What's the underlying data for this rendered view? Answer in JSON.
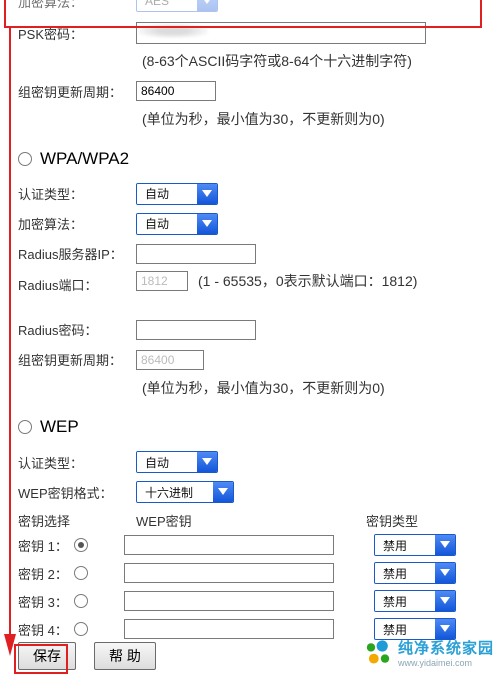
{
  "top": {
    "encrypt_algo_label": "加密算法：",
    "encrypt_algo_value": "AES",
    "psk_label": "PSK密码：",
    "psk_value": "",
    "psk_hint": "(8-63个ASCII码字符或8-64个十六进制字符)",
    "group_key_label": "组密钥更新周期：",
    "group_key_value": "86400",
    "group_key_hint": "(单位为秒，最小值为30，不更新则为0)"
  },
  "wpa": {
    "section_title": "WPA/WPA2",
    "auth_label": "认证类型：",
    "auth_value": "自动",
    "encrypt_label": "加密算法：",
    "encrypt_value": "自动",
    "radius_ip_label": "Radius服务器IP：",
    "radius_ip_value": "",
    "radius_port_label": "Radius端口：",
    "radius_port_value": "1812",
    "radius_port_hint": "(1 - 65535，0表示默认端口：1812)",
    "radius_pw_label": "Radius密码：",
    "radius_pw_value": "",
    "group_key_label": "组密钥更新周期：",
    "group_key_value": "86400",
    "group_key_hint": "(单位为秒，最小值为30，不更新则为0)"
  },
  "wep": {
    "section_title": "WEP",
    "auth_label": "认证类型：",
    "auth_value": "自动",
    "format_label": "WEP密钥格式：",
    "format_value": "十六进制",
    "col_select": "密钥选择",
    "col_key": "WEP密钥",
    "col_type": "密钥类型",
    "keys": [
      {
        "label": "密钥 1：",
        "value": "",
        "type": "禁用",
        "selected": true
      },
      {
        "label": "密钥 2：",
        "value": "",
        "type": "禁用",
        "selected": false
      },
      {
        "label": "密钥 3：",
        "value": "",
        "type": "禁用",
        "selected": false
      },
      {
        "label": "密钥 4：",
        "value": "",
        "type": "禁用",
        "selected": false
      }
    ]
  },
  "buttons": {
    "save": "保存",
    "help": "帮 助"
  },
  "watermark": {
    "line1": "纯净系统家园",
    "line2": "www.yidaimei.com"
  }
}
